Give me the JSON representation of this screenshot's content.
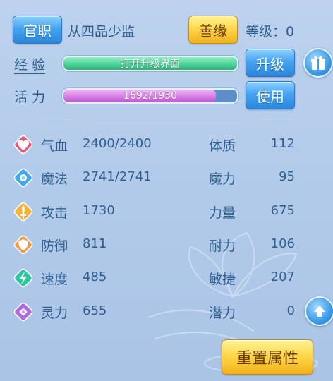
{
  "header": {
    "title_button": "官职",
    "title_name": "从四品少监",
    "karma_button": "善缘",
    "level_label": "等级",
    "level_value": "：0"
  },
  "experience": {
    "label": "经 验",
    "bar_text": "打开升级界面",
    "fill_fraction": 1.0,
    "fill_color": "#4fd49a",
    "upgrade_button": "升级",
    "gift_icon": "gift-icon"
  },
  "vitality": {
    "label": "活 力",
    "current": 1692,
    "max": 1930,
    "bar_text": "1692/1930",
    "fill_color": "#d77ee6",
    "use_button": "使用"
  },
  "stats_left": [
    {
      "label": "气血",
      "value": "2400/2400",
      "icon": "heart-icon",
      "color": "#e25a7a"
    },
    {
      "label": "魔法",
      "value": "2741/2741",
      "icon": "mana-icon",
      "color": "#3fa8ef"
    },
    {
      "label": "攻击",
      "value": "1730",
      "icon": "sword-icon",
      "color": "#f2b33a"
    },
    {
      "label": "防御",
      "value": "811",
      "icon": "shield-icon",
      "color": "#f09a46"
    },
    {
      "label": "速度",
      "value": "485",
      "icon": "lightning-icon",
      "color": "#2ec7a2"
    },
    {
      "label": "灵力",
      "value": "655",
      "icon": "spirit-icon",
      "color": "#b16be0"
    }
  ],
  "stats_right": [
    {
      "label": "体质",
      "value": "112"
    },
    {
      "label": "魔力",
      "value": "95"
    },
    {
      "label": "力量",
      "value": "675"
    },
    {
      "label": "耐力",
      "value": "106"
    },
    {
      "label": "敏捷",
      "value": "207"
    },
    {
      "label": "潜力",
      "value": "0"
    }
  ],
  "footer": {
    "reset_button": "重置属性",
    "add_points_icon": "arrow-up-icon"
  }
}
